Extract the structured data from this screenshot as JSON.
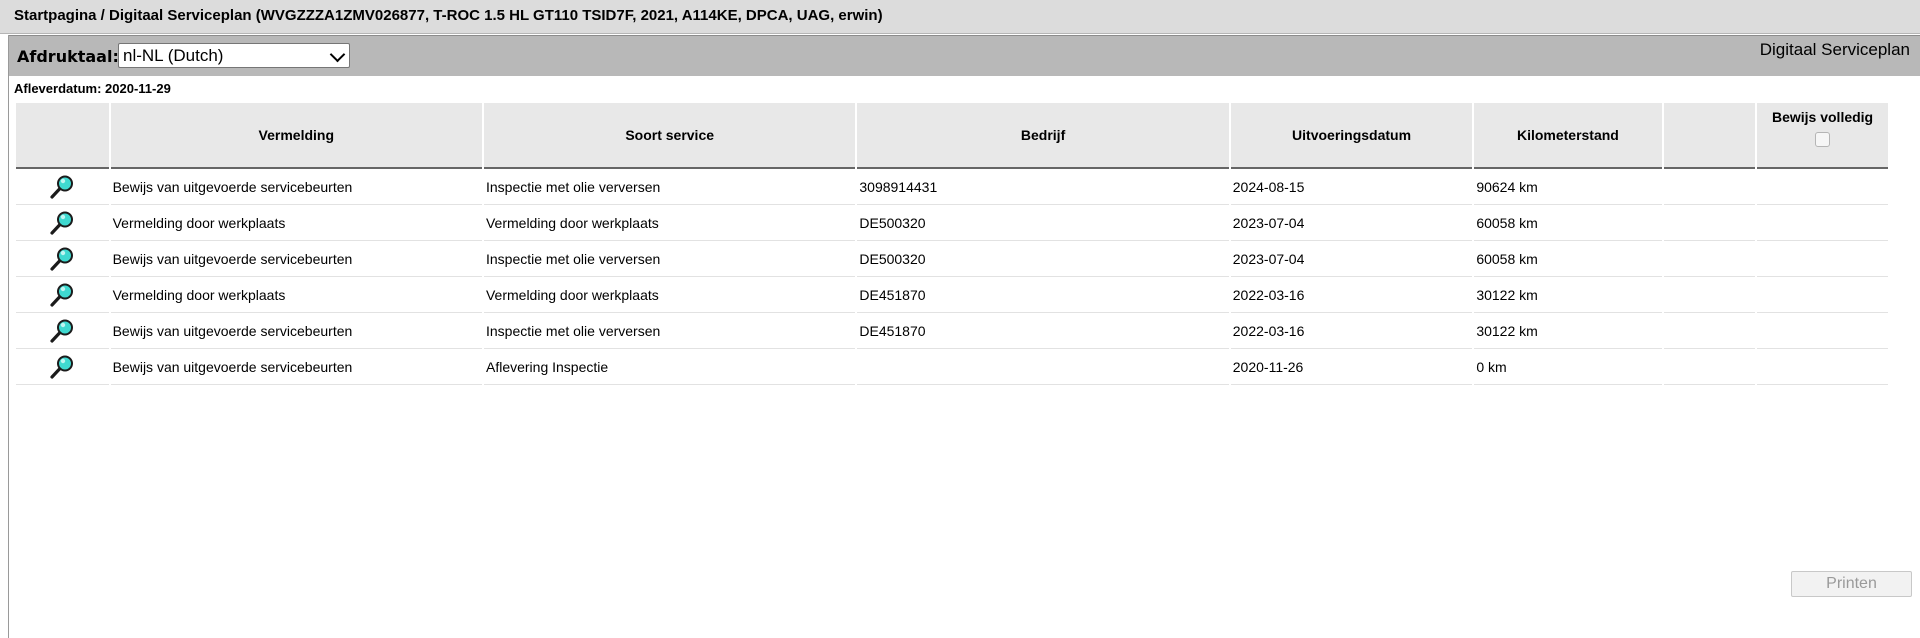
{
  "breadcrumb": "Startpagina / Digitaal Serviceplan (WVGZZZA1ZMV026877, T-ROC 1.5 HL GT110 TSID7F, 2021, A114KE, DPCA, UAG, erwin)",
  "toolbar": {
    "print_label": "Afdruktaal:",
    "language_selected": "nl-NL (Dutch)",
    "app_title": "Digitaal Serviceplan"
  },
  "delivery_date": "Afleverdatum: 2020-11-29",
  "table": {
    "headers": [
      "",
      "Vermelding",
      "Soort service",
      "Bedrijf",
      "Uitvoeringsdatum",
      "Kilometerstand",
      "",
      "Bewijs volledig"
    ],
    "rows": [
      {
        "entry": "Bewijs van uitgevoerde servicebeurten",
        "service": "Inspectie met olie verversen",
        "company": "3098914431",
        "date": "2024-08-15",
        "km": "90624 km"
      },
      {
        "entry": "Vermelding door werkplaats",
        "service": "Vermelding door werkplaats",
        "company": "DE500320",
        "date": "2023-07-04",
        "km": "60058 km"
      },
      {
        "entry": "Bewijs van uitgevoerde servicebeurten",
        "service": "Inspectie met olie verversen",
        "company": "DE500320",
        "date": "2023-07-04",
        "km": "60058 km"
      },
      {
        "entry": "Vermelding door werkplaats",
        "service": "Vermelding door werkplaats",
        "company": "DE451870",
        "date": "2022-03-16",
        "km": "30122 km"
      },
      {
        "entry": "Bewijs van uitgevoerde servicebeurten",
        "service": "Inspectie met olie verversen",
        "company": "DE451870",
        "date": "2022-03-16",
        "km": "30122 km"
      },
      {
        "entry": "Bewijs van uitgevoerde servicebeurten",
        "service": "Aflevering Inspectie",
        "company": "",
        "date": "2020-11-26",
        "km": "0 km"
      }
    ]
  },
  "print_button": "Printen",
  "icons": {
    "row_action": "magnifier-icon"
  },
  "colors": {
    "header_bg": "#e8e8e8",
    "toolbar_bg": "#b8b8b8",
    "topbar_bg": "#dcdcdc",
    "magnifier_lens": "#3fd9d0"
  }
}
